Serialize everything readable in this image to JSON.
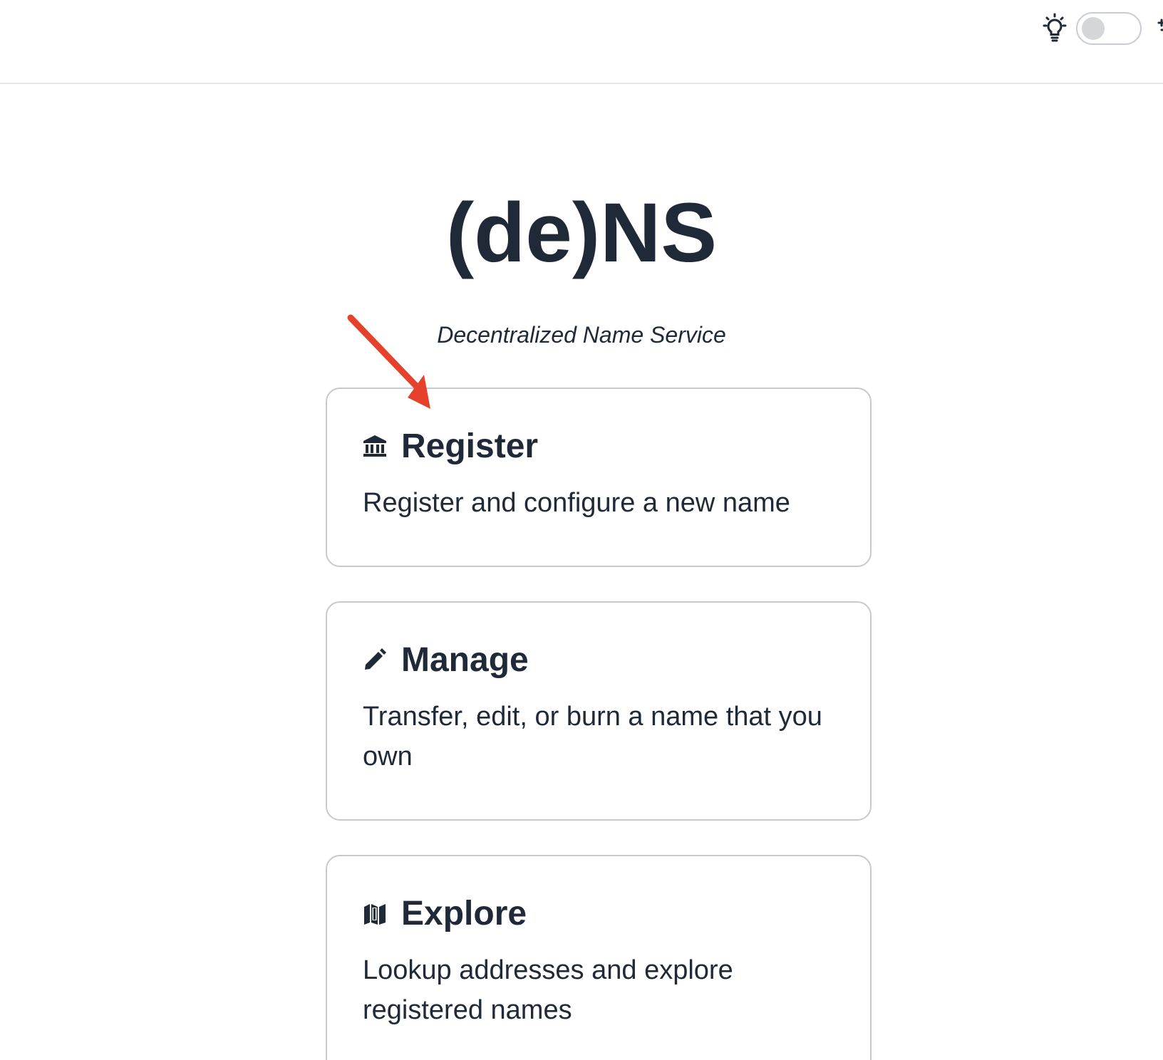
{
  "header": {
    "theme_icon": "lightbulb-icon",
    "theme_toggle_on": false
  },
  "hero": {
    "title": "(de)NS",
    "subtitle": "Decentralized Name Service"
  },
  "cards": [
    {
      "icon": "bank-icon",
      "title": "Register",
      "description": "Register and configure a new name"
    },
    {
      "icon": "pencil-icon",
      "title": "Manage",
      "description": "Transfer, edit, or burn a name that you own"
    },
    {
      "icon": "map-icon",
      "title": "Explore",
      "description": "Lookup addresses and explore registered names"
    }
  ],
  "colors": {
    "text": "#1f2937",
    "border": "#c6cad0",
    "annotation_arrow": "#e5412b"
  }
}
